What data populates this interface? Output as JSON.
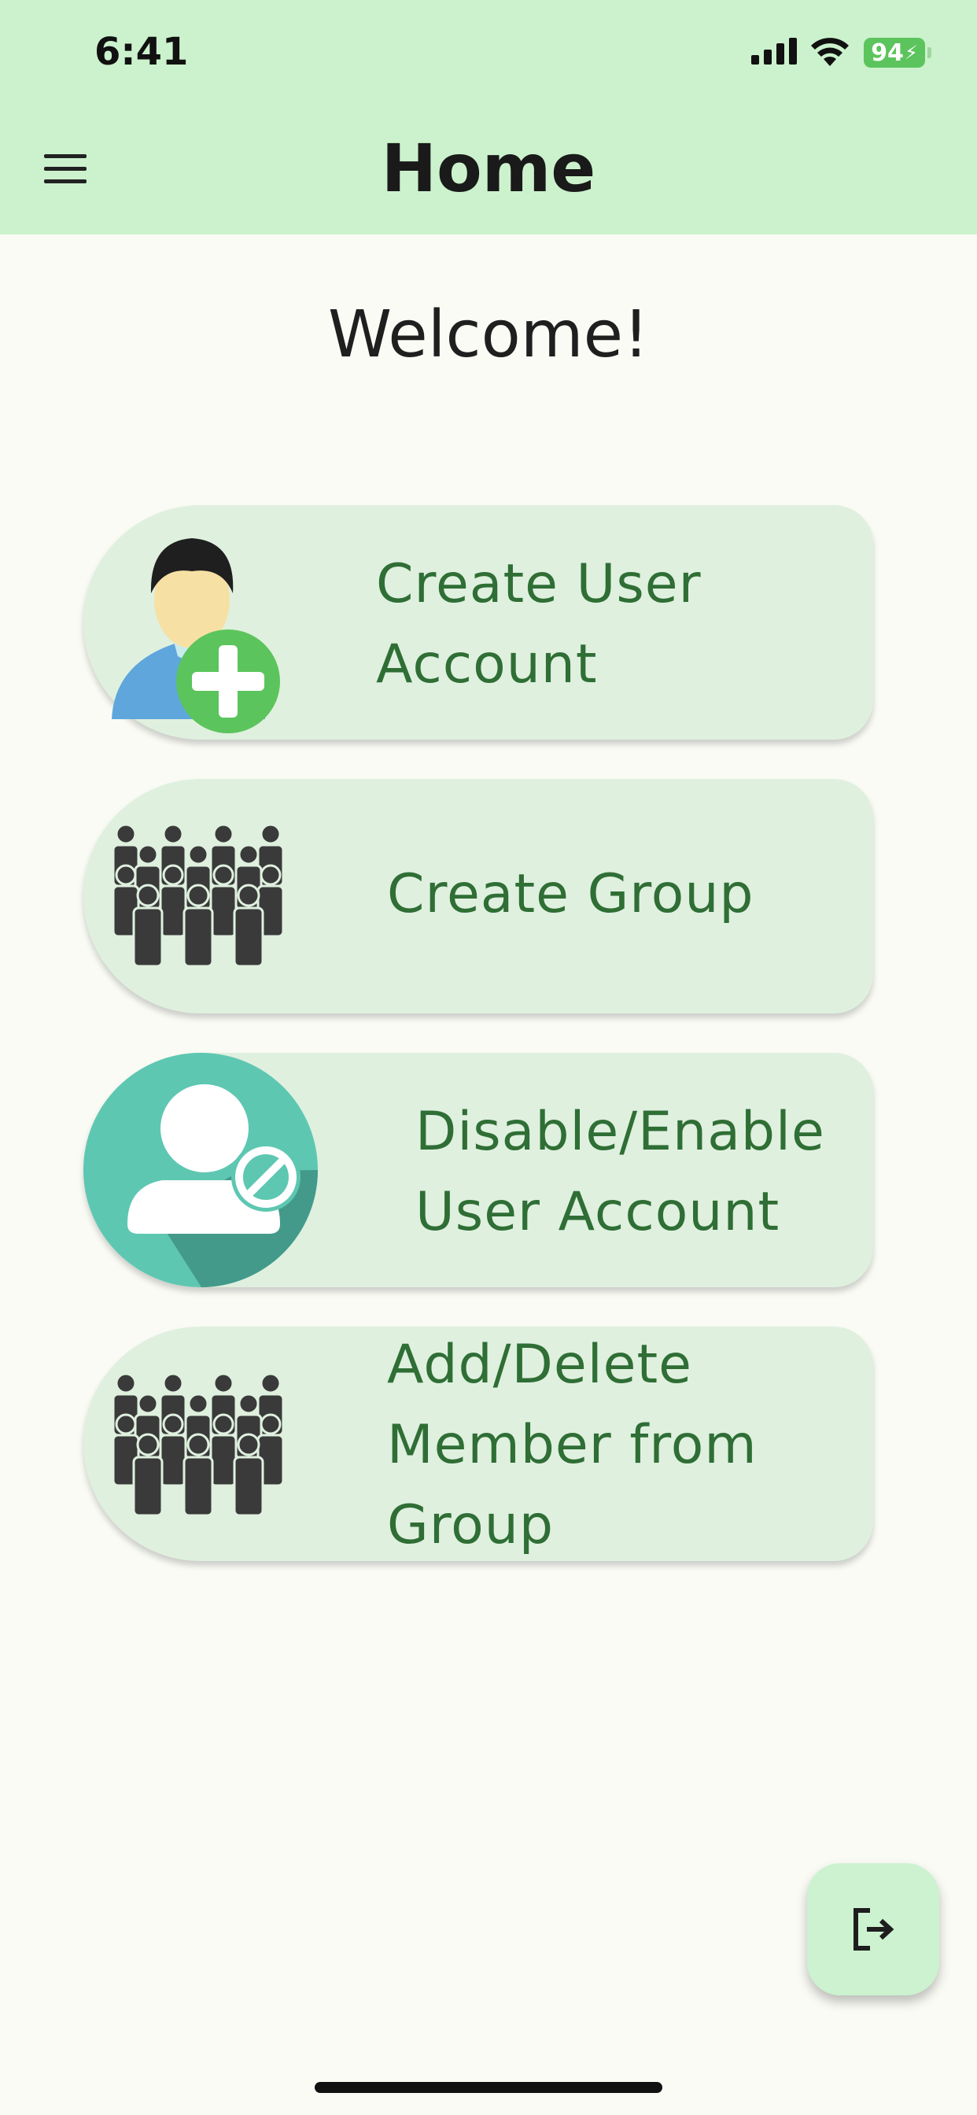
{
  "status_bar": {
    "time": "6:41",
    "battery_percent": "94"
  },
  "header": {
    "title": "Home",
    "menu_icon": "hamburger-menu-icon"
  },
  "welcome_text": "Welcome!",
  "cards": [
    {
      "icon": "user-add-icon",
      "label_lines": [
        "Create User",
        "Account"
      ]
    },
    {
      "icon": "group-icon",
      "label_lines": [
        "Create Group"
      ]
    },
    {
      "icon": "user-disable-icon",
      "label_lines": [
        "Disable/Enable",
        "User Account"
      ]
    },
    {
      "icon": "group-icon",
      "label_lines": [
        "Add/Delete",
        "Member from",
        "Group"
      ]
    }
  ],
  "fab": {
    "icon": "logout-icon"
  },
  "colors": {
    "header_bg": "#cbf2cc",
    "card_bg": "#dff0df",
    "card_text": "#2f6e35",
    "page_bg": "#fafbf5"
  }
}
